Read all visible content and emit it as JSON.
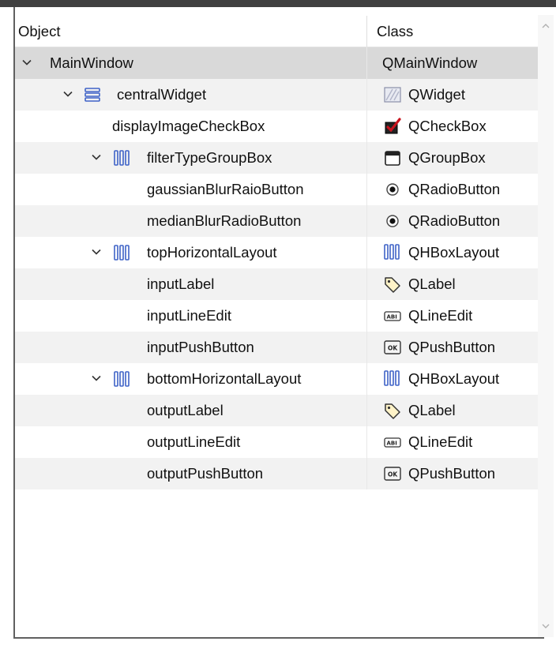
{
  "header": {
    "object_label": "Object",
    "class_label": "Class"
  },
  "rows": [
    {
      "name": "MainWindow",
      "class": "QMainWindow",
      "icon": "none",
      "class_icon": "none",
      "expander": true,
      "depth": 0
    },
    {
      "name": "centralWidget",
      "class": "QWidget",
      "icon": "vertical-layout-icon",
      "class_icon": "widget-icon",
      "expander": true,
      "depth": 1
    },
    {
      "name": "displayImageCheckBox",
      "class": "QCheckBox",
      "icon": "none",
      "class_icon": "checkbox-icon",
      "expander": false,
      "depth": 2
    },
    {
      "name": "filterTypeGroupBox",
      "class": "QGroupBox",
      "icon": "horizontal-layout-icon",
      "class_icon": "groupbox-icon",
      "expander": true,
      "depth": 2
    },
    {
      "name": "gaussianBlurRaioButton",
      "class": "QRadioButton",
      "icon": "none",
      "class_icon": "radio-button-icon",
      "expander": false,
      "depth": 3
    },
    {
      "name": "medianBlurRadioButton",
      "class": "QRadioButton",
      "icon": "none",
      "class_icon": "radio-button-icon",
      "expander": false,
      "depth": 3
    },
    {
      "name": "topHorizontalLayout",
      "class": "QHBoxLayout",
      "icon": "horizontal-layout-icon",
      "class_icon": "horizontal-layout-icon",
      "expander": true,
      "depth": 2
    },
    {
      "name": "inputLabel",
      "class": "QLabel",
      "icon": "none",
      "class_icon": "label-tag-icon",
      "expander": false,
      "depth": 3
    },
    {
      "name": "inputLineEdit",
      "class": "QLineEdit",
      "icon": "none",
      "class_icon": "line-edit-icon",
      "expander": false,
      "depth": 3
    },
    {
      "name": "inputPushButton",
      "class": "QPushButton",
      "icon": "none",
      "class_icon": "push-button-icon",
      "expander": false,
      "depth": 3
    },
    {
      "name": "bottomHorizontalLayout",
      "class": "QHBoxLayout",
      "icon": "horizontal-layout-icon",
      "class_icon": "horizontal-layout-icon",
      "expander": true,
      "depth": 2
    },
    {
      "name": "outputLabel",
      "class": "QLabel",
      "icon": "none",
      "class_icon": "label-tag-icon",
      "expander": false,
      "depth": 3
    },
    {
      "name": "outputLineEdit",
      "class": "QLineEdit",
      "icon": "none",
      "class_icon": "line-edit-icon",
      "expander": false,
      "depth": 3
    },
    {
      "name": "outputPushButton",
      "class": "QPushButton",
      "icon": "none",
      "class_icon": "push-button-icon",
      "expander": false,
      "depth": 3
    }
  ],
  "selected_row": 0,
  "colors": {
    "selected": "#d9d9d9",
    "alternate": "#f2f2f2",
    "layout_icon": "#3f63c7",
    "checkbox_check": "#c8141e"
  }
}
